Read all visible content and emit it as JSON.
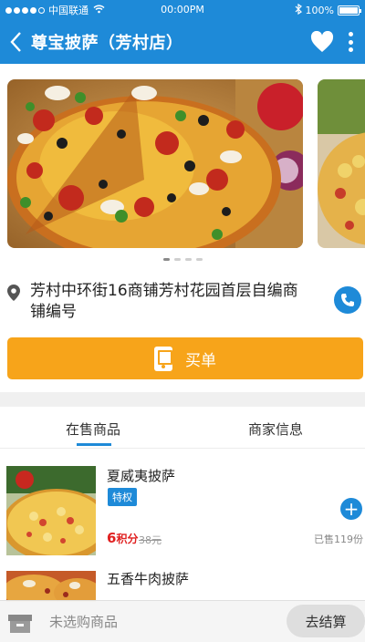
{
  "status_bar": {
    "carrier": "中国联通",
    "time": "00:00PM",
    "battery": "100%",
    "battery_level": 1.0
  },
  "header": {
    "title": "尊宝披萨（芳村店）",
    "icons": [
      "back-icon",
      "heart-icon",
      "more-icon"
    ]
  },
  "banner": {
    "slides": [
      "pizza-photo-1",
      "pizza-photo-2"
    ],
    "page_count": 4,
    "active_page": 1
  },
  "store": {
    "address": "芳村中环街16商铺芳村花园首层自编商铺编号"
  },
  "pay_button": {
    "label": "买单"
  },
  "tabs": [
    {
      "label": "在售商品",
      "active": true
    },
    {
      "label": "商家信息",
      "active": false
    }
  ],
  "products": [
    {
      "name": "夏威夷披萨",
      "tag": "特权",
      "price": "6",
      "price_unit": "积分",
      "original_price": "38元",
      "sold": "已售119份"
    },
    {
      "name": "五香牛肉披萨"
    }
  ],
  "cart": {
    "empty_text": "未选购商品",
    "checkout_label": "去结算"
  },
  "colors": {
    "primary": "#1e8ad8",
    "accent": "#f7a41a",
    "price": "#e02020"
  }
}
